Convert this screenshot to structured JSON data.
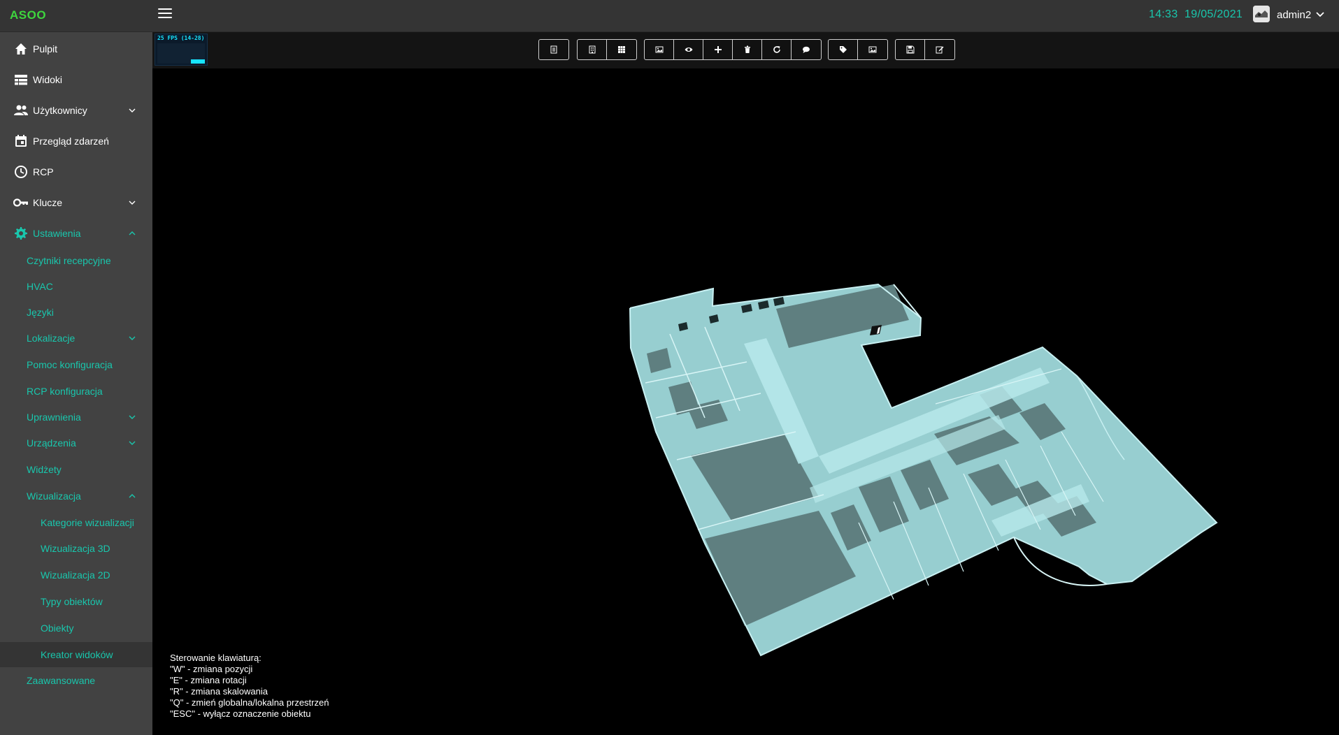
{
  "header": {
    "brand": "ASOO",
    "time": "14:33",
    "date": "19/05/2021",
    "username": "admin2",
    "accent_color": "#19c7ad",
    "brand_color": "#3ed63e"
  },
  "sidebar": {
    "items": [
      {
        "label": "Pulpit",
        "icon": "home-icon"
      },
      {
        "label": "Widoki",
        "icon": "view-list-icon"
      },
      {
        "label": "Użytkownicy",
        "icon": "users-icon",
        "expandable": true
      },
      {
        "label": "Przegląd zdarzeń",
        "icon": "calendar-icon"
      },
      {
        "label": "RCP",
        "icon": "clock-icon"
      },
      {
        "label": "Klucze",
        "icon": "key-icon",
        "expandable": true
      },
      {
        "label": "Ustawienia",
        "icon": "gear-icon",
        "expanded": true
      }
    ],
    "settings_sub": [
      {
        "label": "Czytniki recepcyjne"
      },
      {
        "label": "HVAC"
      },
      {
        "label": "Języki"
      },
      {
        "label": "Lokalizacje",
        "expandable": true
      },
      {
        "label": "Pomoc konfiguracja"
      },
      {
        "label": "RCP konfiguracja"
      },
      {
        "label": "Uprawnienia",
        "expandable": true
      },
      {
        "label": "Urządzenia",
        "expandable": true
      },
      {
        "label": "Widżety"
      },
      {
        "label": "Wizualizacja",
        "expanded": true
      }
    ],
    "visualization_sub": [
      {
        "label": "Kategorie wizualizacji"
      },
      {
        "label": "Wizualizacja 3D"
      },
      {
        "label": "Wizualizacja 2D"
      },
      {
        "label": "Typy obiektów"
      },
      {
        "label": "Obiekty"
      },
      {
        "label": "Kreator widoków",
        "selected": true
      }
    ],
    "bottom_item": {
      "label": "Zaawansowane"
    }
  },
  "viewport": {
    "fps_label": "25 FPS (14-28)",
    "toolbar_icons": [
      [
        "file-icon"
      ],
      [
        "building-icon",
        "grid-icon"
      ],
      [
        "image-icon",
        "eye-icon",
        "plus-icon",
        "trash-icon",
        "refresh-icon",
        "comment-icon"
      ],
      [
        "tag-icon",
        "picture-icon"
      ],
      [
        "save-icon",
        "edit-icon"
      ]
    ],
    "help_title": "Sterowanie klawiaturą:",
    "help_lines": [
      "\"W\" - zmiana pozycji",
      "\"E\" - zmiana rotacji",
      "\"R\" - zmiana skalowania",
      "\"Q\" - zmień globalna/lokalna przestrzeń",
      "\"ESC\" - wyłącz oznaczenie obiektu"
    ],
    "model_color": "#a6e0e2"
  }
}
